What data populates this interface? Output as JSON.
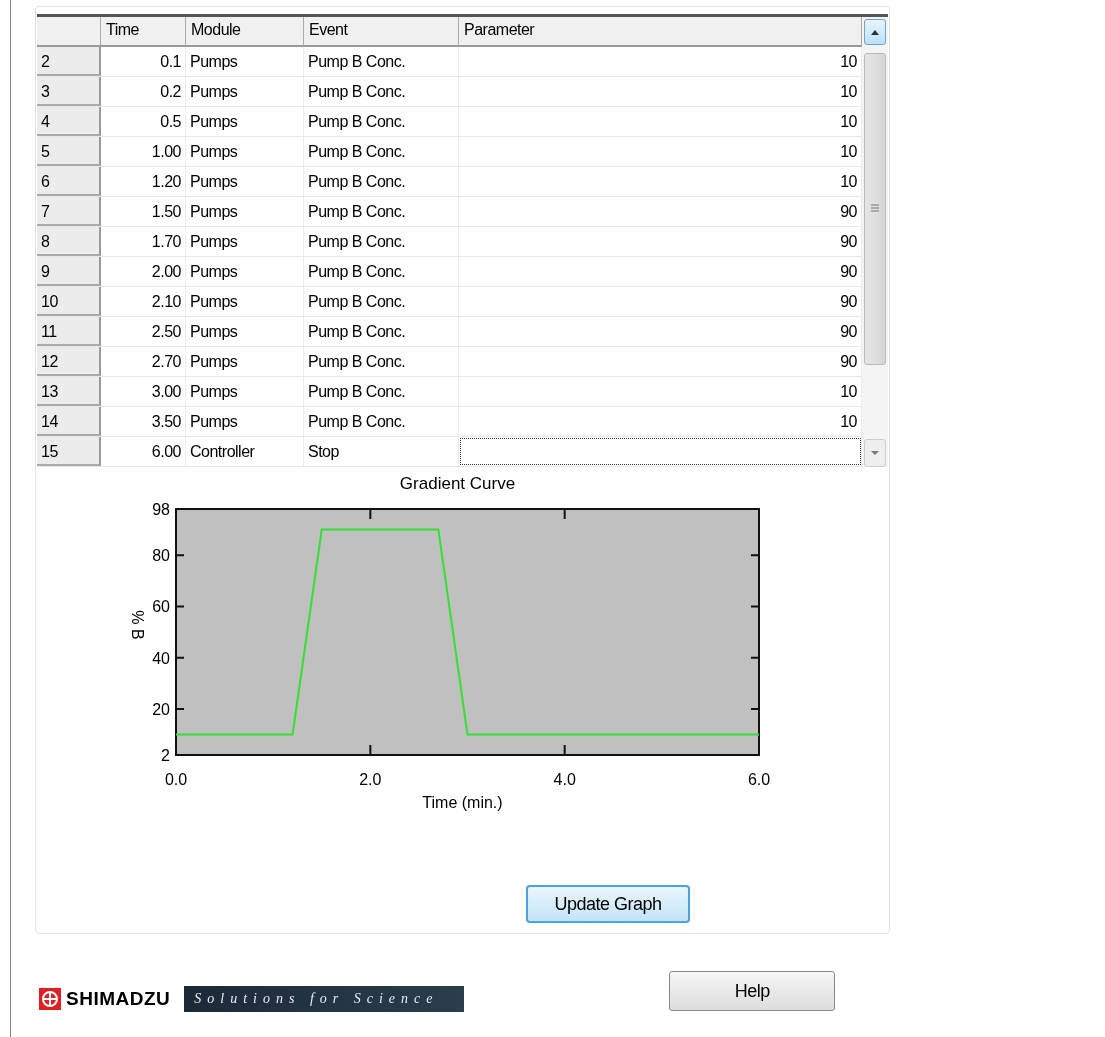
{
  "table": {
    "columns": [
      "Time",
      "Module",
      "Event",
      "Parameter"
    ],
    "rows": [
      {
        "number": "2",
        "time": "0.1",
        "module": "Pumps",
        "event": "Pump B Conc.",
        "parameter": "10",
        "focused": false
      },
      {
        "number": "3",
        "time": "0.2",
        "module": "Pumps",
        "event": "Pump B Conc.",
        "parameter": "10",
        "focused": false
      },
      {
        "number": "4",
        "time": "0.5",
        "module": "Pumps",
        "event": "Pump B Conc.",
        "parameter": "10",
        "focused": false
      },
      {
        "number": "5",
        "time": "1.00",
        "module": "Pumps",
        "event": "Pump B Conc.",
        "parameter": "10",
        "focused": false
      },
      {
        "number": "6",
        "time": "1.20",
        "module": "Pumps",
        "event": "Pump B Conc.",
        "parameter": "10",
        "focused": false
      },
      {
        "number": "7",
        "time": "1.50",
        "module": "Pumps",
        "event": "Pump B Conc.",
        "parameter": "90",
        "focused": false
      },
      {
        "number": "8",
        "time": "1.70",
        "module": "Pumps",
        "event": "Pump B Conc.",
        "parameter": "90",
        "focused": false
      },
      {
        "number": "9",
        "time": "2.00",
        "module": "Pumps",
        "event": "Pump B Conc.",
        "parameter": "90",
        "focused": false
      },
      {
        "number": "10",
        "time": "2.10",
        "module": "Pumps",
        "event": "Pump B Conc.",
        "parameter": "90",
        "focused": false
      },
      {
        "number": "11",
        "time": "2.50",
        "module": "Pumps",
        "event": "Pump B Conc.",
        "parameter": "90",
        "focused": false
      },
      {
        "number": "12",
        "time": "2.70",
        "module": "Pumps",
        "event": "Pump B Conc.",
        "parameter": "90",
        "focused": false
      },
      {
        "number": "13",
        "time": "3.00",
        "module": "Pumps",
        "event": "Pump B Conc.",
        "parameter": "10",
        "focused": false
      },
      {
        "number": "14",
        "time": "3.50",
        "module": "Pumps",
        "event": "Pump B Conc.",
        "parameter": "10",
        "focused": false
      },
      {
        "number": "15",
        "time": "6.00",
        "module": "Controller",
        "event": "Stop",
        "focused": true
      }
    ]
  },
  "chart": {
    "chart_data": {
      "type": "line",
      "title": "Gradient Curve",
      "xlabel": "Time (min.)",
      "ylabel": "% B",
      "xlim": [
        0,
        6
      ],
      "ylim": [
        2,
        98
      ],
      "xticks": [
        {
          "value": 0,
          "label": "0.0"
        },
        {
          "value": 2,
          "label": "2.0"
        },
        {
          "value": 4,
          "label": "4.0"
        },
        {
          "value": 6,
          "label": "6.0"
        }
      ],
      "yticks": [
        2,
        20,
        40,
        60,
        80,
        98
      ],
      "x": [
        0,
        1.2,
        1.5,
        2.7,
        3.0,
        6.0
      ],
      "series": [
        {
          "color": "#33e033",
          "values": [
            10,
            10,
            90,
            90,
            10,
            10
          ]
        }
      ]
    }
  },
  "update_button": "Update Graph",
  "footer": {
    "brand": "SHIMADZU",
    "tagline": "Solutions for Science",
    "help_button": "Help"
  }
}
